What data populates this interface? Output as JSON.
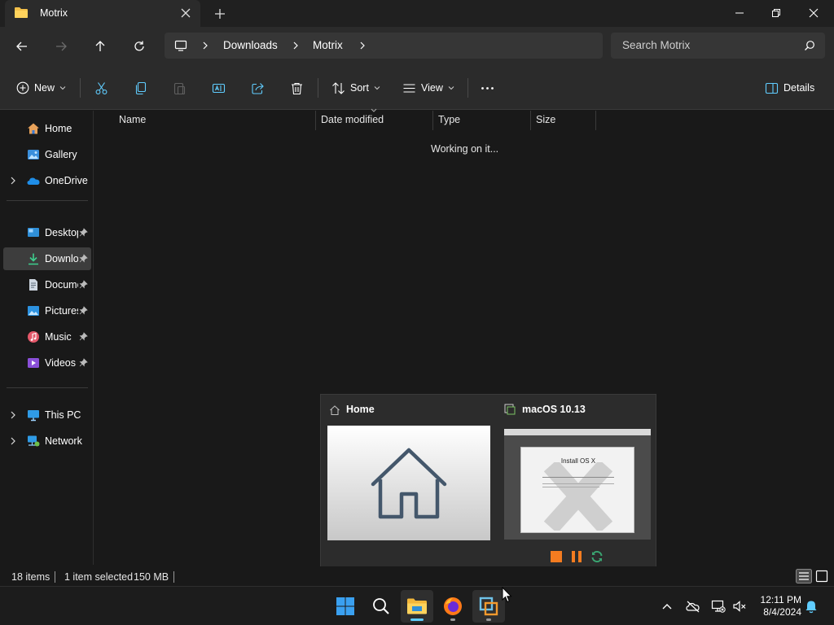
{
  "window": {
    "tab_title": "Motrix"
  },
  "breadcrumb": {
    "items": [
      "Downloads",
      "Motrix"
    ]
  },
  "search": {
    "placeholder": "Search Motrix"
  },
  "command_bar": {
    "new_label": "New",
    "sort_label": "Sort",
    "view_label": "View",
    "details_label": "Details"
  },
  "sidebar": {
    "items": [
      {
        "label": "Home",
        "icon": "home-icon"
      },
      {
        "label": "Gallery",
        "icon": "gallery-icon"
      },
      {
        "label": "OneDrive",
        "icon": "onedrive-icon"
      },
      {
        "label": "Desktop",
        "icon": "desktop-icon"
      },
      {
        "label": "Downloads",
        "icon": "downloads-icon"
      },
      {
        "label": "Documents",
        "icon": "documents-icon"
      },
      {
        "label": "Pictures",
        "icon": "pictures-icon"
      },
      {
        "label": "Music",
        "icon": "music-icon"
      },
      {
        "label": "Videos",
        "icon": "videos-icon"
      },
      {
        "label": "This PC",
        "icon": "this-pc-icon"
      },
      {
        "label": "Network",
        "icon": "network-icon"
      }
    ]
  },
  "file_list": {
    "columns": [
      "Name",
      "Date modified",
      "Type",
      "Size"
    ],
    "loading_text": "Working on it..."
  },
  "status": {
    "items_count": "18 items",
    "selection": "1 item selected",
    "size": "150 MB"
  },
  "thumbnails": {
    "home_title": "Home",
    "vm_title": "macOS 10.13",
    "vm_screen_heading": "Install OS X"
  },
  "clock": {
    "time": "12:11 PM",
    "date": "8/4/2024"
  },
  "colors": {
    "accent": "#60cdff",
    "vm_control": "#f47c20"
  }
}
